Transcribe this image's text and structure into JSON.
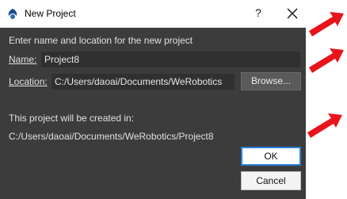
{
  "window": {
    "title": "New Project",
    "help_label": "?"
  },
  "dialog": {
    "instruction": "Enter name and location for the new project",
    "name_label": "Name:",
    "name_value": "Project8",
    "location_label": "Location:",
    "location_value": "C:/Users/daoai/Documents/WeRobotics",
    "browse_label": "Browse...",
    "created_label": "This project will be created in:",
    "created_path": "C:/Users/daoai/Documents/WeRobotics/Project8",
    "ok_label": "OK",
    "cancel_label": "Cancel"
  },
  "colors": {
    "dialog_bg": "#3c3c3c",
    "accent_arrow": "#e8141c",
    "ok_border": "#2a7fd4"
  },
  "icons": [
    "app-icon",
    "close-icon",
    "red-arrow-icon"
  ]
}
